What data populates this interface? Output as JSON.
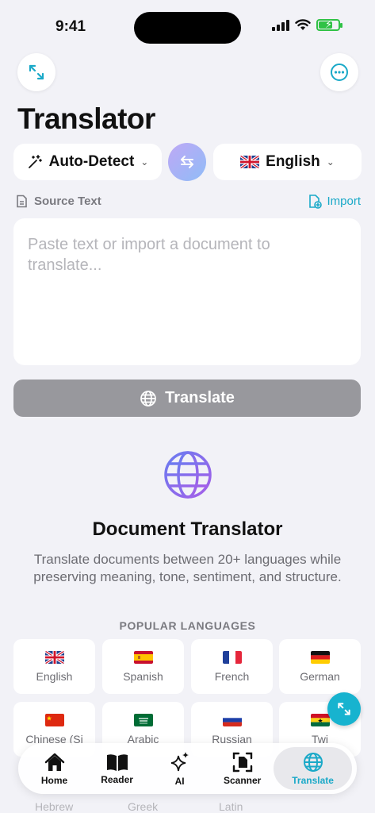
{
  "status_bar": {
    "time": "9:41"
  },
  "header": {
    "title": "Translator"
  },
  "languages": {
    "source": "Auto-Detect",
    "target": "English"
  },
  "source_section": {
    "label": "Source Text",
    "import_label": "Import",
    "placeholder": "Paste text or import a document to translate..."
  },
  "translate_button": {
    "label": "Translate"
  },
  "hero": {
    "title": "Document Translator",
    "description": "Translate documents between 20+ languages while preserving meaning, tone, sentiment, and structure."
  },
  "popular": {
    "label": "POPULAR LANGUAGES",
    "row1": [
      "English",
      "Spanish",
      "French",
      "German"
    ],
    "row2": [
      "Chinese (Si",
      "Arabic",
      "Russian",
      "Twi"
    ],
    "row3": [
      "Hebrew",
      "Greek",
      "Latin"
    ]
  },
  "tabs": [
    {
      "label": "Home",
      "icon": "house-icon"
    },
    {
      "label": "Reader",
      "icon": "book-icon"
    },
    {
      "label": "AI",
      "icon": "sparkles-icon"
    },
    {
      "label": "Scanner",
      "icon": "scanner-icon"
    },
    {
      "label": "Translate",
      "icon": "globe-icon"
    }
  ],
  "colors": {
    "accent": "#1aa9c8",
    "button_disabled": "#98989d",
    "background": "#f2f2f7"
  }
}
